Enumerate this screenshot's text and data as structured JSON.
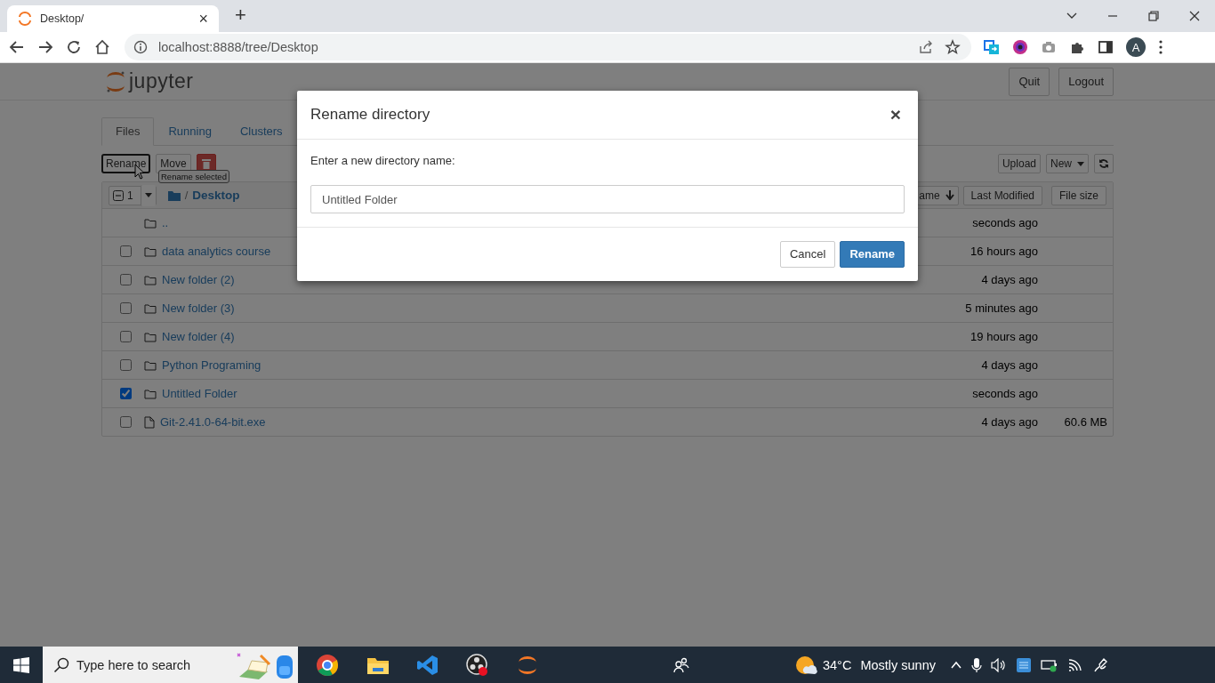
{
  "browser": {
    "tab_title": "Desktop/",
    "close": "×",
    "new_tab": "+",
    "url": "localhost:8888/tree/Desktop",
    "profile": "A"
  },
  "header": {
    "logo": "jupyter",
    "buttons": [
      "Quit",
      "Logout"
    ]
  },
  "tabs": [
    {
      "label": "Files",
      "selected": true
    },
    {
      "label": "Running",
      "selected": false
    },
    {
      "label": "Clusters",
      "selected": false
    }
  ],
  "toolbar": {
    "rename": "Rename",
    "move": "Move",
    "tooltip": "Rename selected",
    "upload": "Upload",
    "new": "New"
  },
  "list_header": {
    "select_all_indeterminate": true,
    "selected_count": "1",
    "separator": "/",
    "breadcrumb": "Desktop",
    "sort_button": "ame",
    "columns": [
      "Last Modified",
      "File size"
    ]
  },
  "rows": [
    {
      "kind": "parent",
      "name": "..",
      "modified": "seconds ago"
    },
    {
      "kind": "folder",
      "name": "data analytics course",
      "checked": false,
      "modified": "16 hours ago"
    },
    {
      "kind": "folder",
      "name": "New folder (2)",
      "checked": false,
      "modified": "4 days ago"
    },
    {
      "kind": "folder",
      "name": "New folder (3)",
      "checked": false,
      "modified": "5 minutes ago"
    },
    {
      "kind": "folder",
      "name": "New folder (4)",
      "checked": false,
      "modified": "19 hours ago"
    },
    {
      "kind": "folder",
      "name": "Python Programing",
      "checked": false,
      "modified": "4 days ago"
    },
    {
      "kind": "folder",
      "name": "Untitled Folder",
      "checked": true,
      "modified": "seconds ago"
    },
    {
      "kind": "file",
      "name": "Git-2.41.0-64-bit.exe",
      "checked": false,
      "modified": "4 days ago",
      "size": "60.6 MB"
    }
  ],
  "dialog": {
    "title": "Rename directory",
    "close": "×",
    "prompt": "Enter a new directory name:",
    "value": "Untitled Folder",
    "buttons": [
      "Cancel",
      "Rename"
    ]
  },
  "taskbar": {
    "search_placeholder": "Type here to search",
    "temperature": "34°C",
    "weather": "Mostly sunny"
  }
}
